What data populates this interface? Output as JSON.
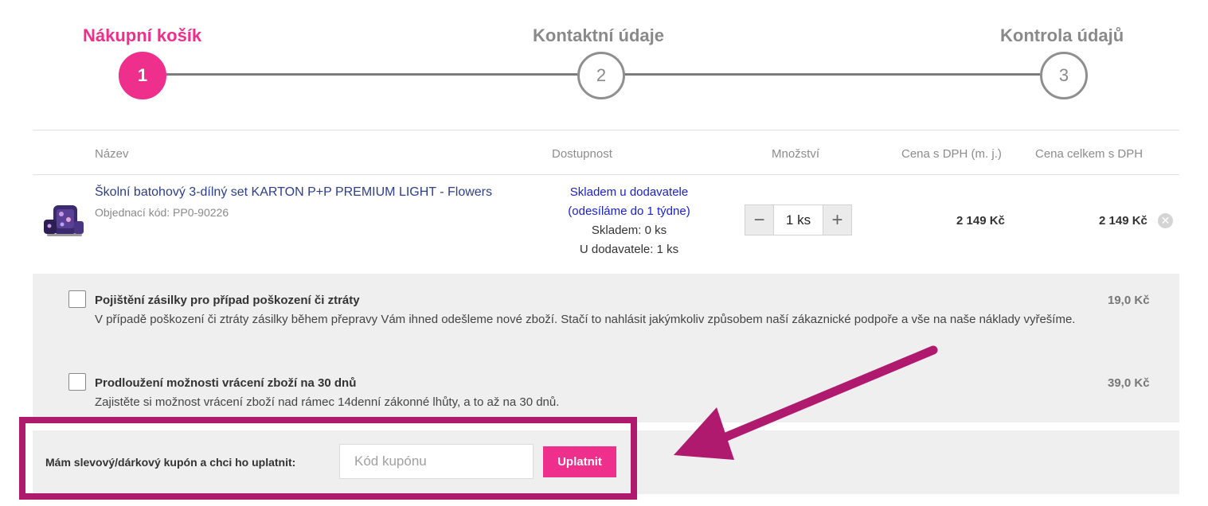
{
  "steps": [
    {
      "number": "1",
      "label": "Nákupní košík",
      "active": true
    },
    {
      "number": "2",
      "label": "Kontaktní údaje",
      "active": false
    },
    {
      "number": "3",
      "label": "Kontrola údajů",
      "active": false
    }
  ],
  "table": {
    "headers": {
      "name": "Název",
      "availability": "Dostupnost",
      "quantity": "Množství",
      "unit_price": "Cena s DPH (m. j.)",
      "total_price": "Cena celkem s DPH"
    }
  },
  "item": {
    "name": "Školní batohový 3-dílný set KARTON P+P PREMIUM LIGHT - Flowers",
    "code": "Objednací kód: PP0-90226",
    "availability_line1": "Skladem u dodavatele",
    "availability_line2": "(odesíláme do 1 týdne)",
    "stock_line": "Skladem: 0 ks",
    "supplier_line": "U dodavatele: 1 ks",
    "quantity": "1 ks",
    "minus": "−",
    "plus": "+",
    "unit_price": "2 149 Kč",
    "total_price": "2 149 Kč",
    "remove_icon": "✕"
  },
  "services": [
    {
      "title": "Pojištění zásilky pro případ poškození či ztráty",
      "description": "V případě poškození či ztráty zásilky během přepravy Vám ihned odešleme nové zboží. Stačí to nahlásit jakýmkoliv způsobem naší zákaznické podpoře a vše na naše náklady vyřešíme.",
      "price": "19,0 Kč"
    },
    {
      "title": "Prodloužení možnosti vrácení zboží na 30 dnů",
      "description": "Zajistěte si možnost vrácení zboží nad rámec 14denní zákonné lhůty, a to až na 30 dnů.",
      "price": "39,0 Kč"
    }
  ],
  "coupon": {
    "label": "Mám slevový/dárkový kupón a chci ho uplatnit:",
    "placeholder": "Kód kupónu",
    "button": "Uplatnit"
  },
  "colors": {
    "accent": "#ef2f8c",
    "annotation": "#b01a6e",
    "link": "#1a23c8",
    "product_link": "#2d3e8c"
  }
}
